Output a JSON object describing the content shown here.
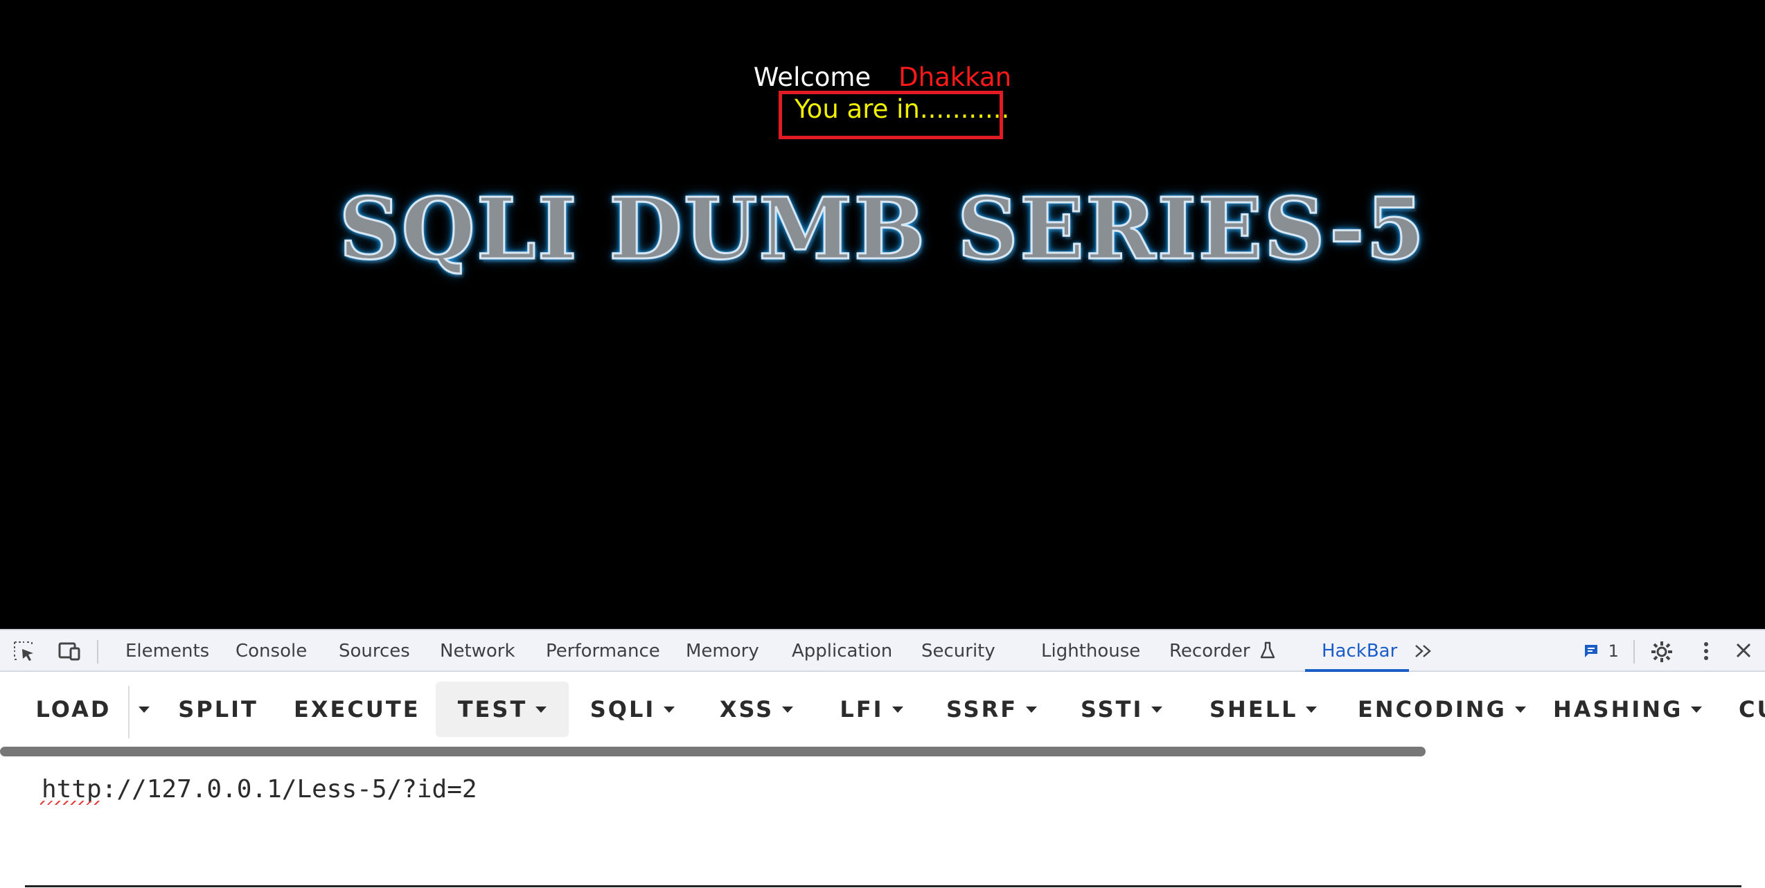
{
  "page": {
    "welcome_label": "Welcome",
    "user_name": "Dhakkan",
    "login_message": "You are in...........",
    "banner_title": "SQLI DUMB SERIES-5"
  },
  "devtools": {
    "tabs": [
      {
        "label": "Elements"
      },
      {
        "label": "Console"
      },
      {
        "label": "Sources"
      },
      {
        "label": "Network"
      },
      {
        "label": "Performance"
      },
      {
        "label": "Memory"
      },
      {
        "label": "Application"
      },
      {
        "label": "Security"
      },
      {
        "label": "Lighthouse"
      },
      {
        "label": "Recorder"
      },
      {
        "label": "HackBar"
      }
    ],
    "active_tab": "HackBar",
    "message_count": "1"
  },
  "hackbar": {
    "buttons": [
      {
        "label": "LOAD"
      },
      {
        "label": "SPLIT"
      },
      {
        "label": "EXECUTE"
      },
      {
        "label": "TEST"
      },
      {
        "label": "SQLI"
      },
      {
        "label": "XSS"
      },
      {
        "label": "LFI"
      },
      {
        "label": "SSRF"
      },
      {
        "label": "SSTI"
      },
      {
        "label": "SHELL"
      },
      {
        "label": "ENCODING"
      },
      {
        "label": "HASHING"
      },
      {
        "label": "CU"
      }
    ],
    "url_value": "http://127.0.0.1/Less-5/?id=2"
  },
  "colors": {
    "accent": "#1a5dc7",
    "welcome_name": "#ff1a1a",
    "login_message": "#f0f000",
    "highlight_box": "#e01b24"
  }
}
